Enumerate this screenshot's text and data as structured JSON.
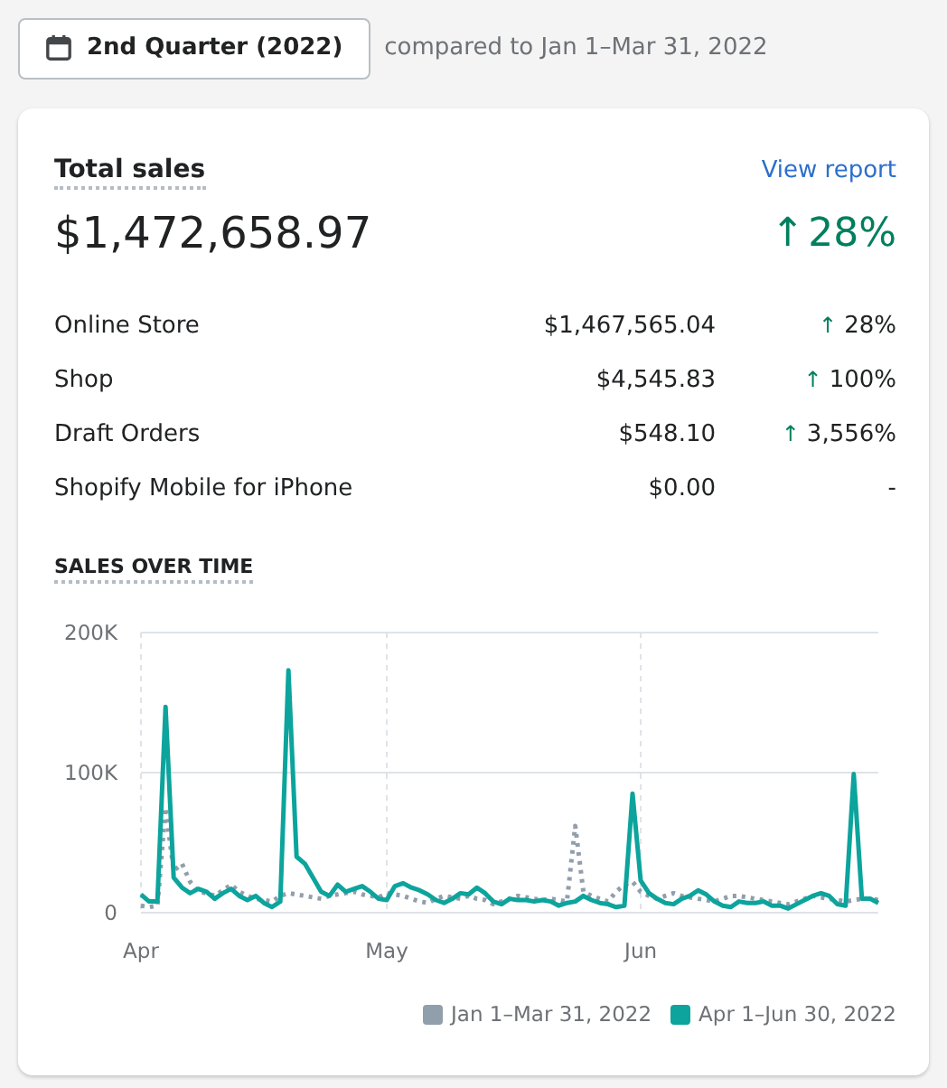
{
  "date_picker": {
    "label": "2nd Quarter (2022)"
  },
  "comparison": "compared to Jan 1–Mar 31, 2022",
  "card": {
    "title": "Total sales",
    "link": "View report",
    "total": "$1,472,658.97",
    "total_change": {
      "arrow": "↑",
      "text": "28%"
    },
    "rows": [
      {
        "name": "Online Store",
        "amount": "$1,467,565.04",
        "arrow": "↑",
        "change": "28%"
      },
      {
        "name": "Shop",
        "amount": "$4,545.83",
        "arrow": "↑",
        "change": "100%"
      },
      {
        "name": "Draft Orders",
        "amount": "$548.10",
        "arrow": "↑",
        "change": "3,556%"
      },
      {
        "name": "Shopify Mobile for iPhone",
        "amount": "$0.00",
        "change": "-"
      }
    ],
    "chart_title": "SALES OVER TIME",
    "chart_data": {
      "type": "line",
      "ref_lines": [
        {
          "axis": "y",
          "value": 100
        }
      ],
      "categories": [
        "Apr",
        null,
        null,
        null,
        null,
        null,
        null,
        null,
        null,
        null,
        null,
        null,
        null,
        null,
        null,
        null,
        null,
        null,
        null,
        null,
        null,
        null,
        null,
        null,
        null,
        null,
        null,
        null,
        null,
        null,
        "May",
        null,
        null,
        null,
        null,
        null,
        null,
        null,
        null,
        null,
        null,
        null,
        null,
        null,
        null,
        null,
        null,
        null,
        null,
        null,
        null,
        null,
        null,
        null,
        null,
        null,
        null,
        null,
        null,
        null,
        null,
        "Jun",
        null,
        null,
        null,
        null,
        null,
        null,
        null,
        null,
        null,
        null,
        null,
        null,
        null,
        null,
        null,
        null,
        null,
        null,
        null,
        null,
        null,
        null,
        null,
        null,
        null,
        null,
        null,
        null,
        null
      ],
      "ylim": [
        0,
        200
      ],
      "yticks": [
        {
          "value": 0,
          "label": "0"
        },
        {
          "value": 100,
          "label": "100K"
        },
        {
          "value": 200,
          "label": "200K"
        }
      ],
      "series": [
        {
          "name": "Jan 1–Mar 31, 2022",
          "color": "#919eab",
          "line_style": "dotted",
          "values": [
            5,
            4,
            5,
            75,
            30,
            35,
            22,
            15,
            14,
            12,
            16,
            20,
            15,
            12,
            10,
            9,
            8,
            12,
            14,
            13,
            12,
            11,
            10,
            12,
            13,
            14,
            15,
            13,
            12,
            11,
            14,
            13,
            12,
            10,
            8,
            7,
            10,
            12,
            11,
            10,
            12,
            10,
            9,
            6,
            8,
            10,
            12,
            11,
            10,
            9,
            10,
            9,
            8,
            62,
            15,
            12,
            10,
            8,
            15,
            20,
            22,
            15,
            12,
            10,
            12,
            14,
            12,
            11,
            10,
            9,
            8,
            10,
            12,
            12,
            11,
            10,
            9,
            8,
            7,
            6,
            8,
            10,
            12,
            11,
            10,
            9,
            8,
            9,
            10,
            10,
            9
          ]
        },
        {
          "name": "Apr 1–Jun 30, 2022",
          "color": "#0ca49c",
          "line_style": "solid",
          "values": [
            13,
            8,
            8,
            147,
            25,
            18,
            14,
            17,
            15,
            10,
            14,
            17,
            12,
            9,
            12,
            7,
            4,
            8,
            173,
            40,
            35,
            25,
            15,
            12,
            20,
            15,
            17,
            19,
            15,
            10,
            9,
            19,
            21,
            18,
            16,
            13,
            9,
            7,
            10,
            14,
            13,
            18,
            14,
            8,
            6,
            10,
            9,
            9,
            8,
            9,
            8,
            5,
            7,
            8,
            12,
            9,
            7,
            6,
            4,
            5,
            85,
            23,
            14,
            10,
            7,
            6,
            10,
            12,
            16,
            13,
            8,
            5,
            4,
            8,
            7,
            7,
            8,
            5,
            5,
            3,
            6,
            9,
            12,
            14,
            12,
            6,
            5,
            99,
            10,
            10,
            7
          ]
        }
      ]
    }
  }
}
